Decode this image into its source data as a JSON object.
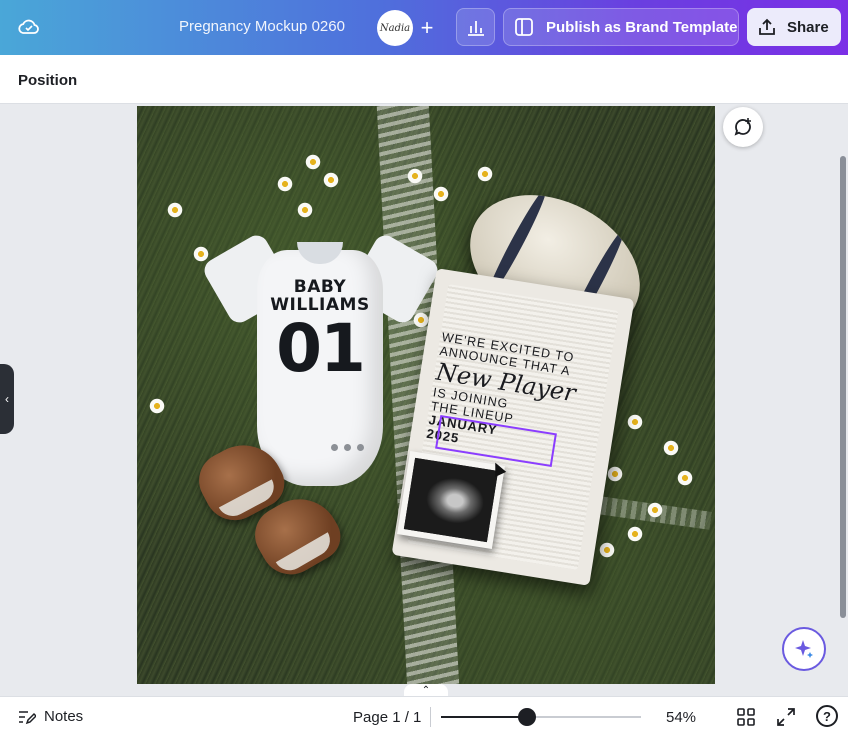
{
  "header": {
    "title": "Pregnancy Mockup 0260",
    "avatar_text": "Nadia",
    "add_symbol": "+",
    "publish_label": "Publish as Brand Template",
    "share_label": "Share",
    "icons": [
      "cloud-icon",
      "plus-icon",
      "bar-chart-icon",
      "template-icon",
      "share-upload-icon"
    ]
  },
  "context_bar": {
    "position_label": "Position"
  },
  "design": {
    "onesie": {
      "line1": "BABY",
      "line2": "WILLIAMS",
      "number": "01"
    },
    "board": {
      "line1": "WE'RE EXCITED TO",
      "line2": "ANNOUNCE THAT A",
      "script": "New Player",
      "line3": "IS JOINING",
      "line4": "THE LINEUP",
      "date1": "JANUARY",
      "date2": "2025"
    }
  },
  "footer": {
    "notes_label": "Notes",
    "page_label": "Page 1 / 1",
    "zoom_label": "54%",
    "zoom_fraction": 0.43,
    "help_symbol": "?",
    "collapse_symbol": "⌃",
    "side_handle_symbol": "‹"
  },
  "colors": {
    "selection": "#8b3dff",
    "header_gradient_start": "#4aa7d8",
    "header_gradient_end": "#7b2fe6",
    "share_bg": "#ecebfb"
  }
}
